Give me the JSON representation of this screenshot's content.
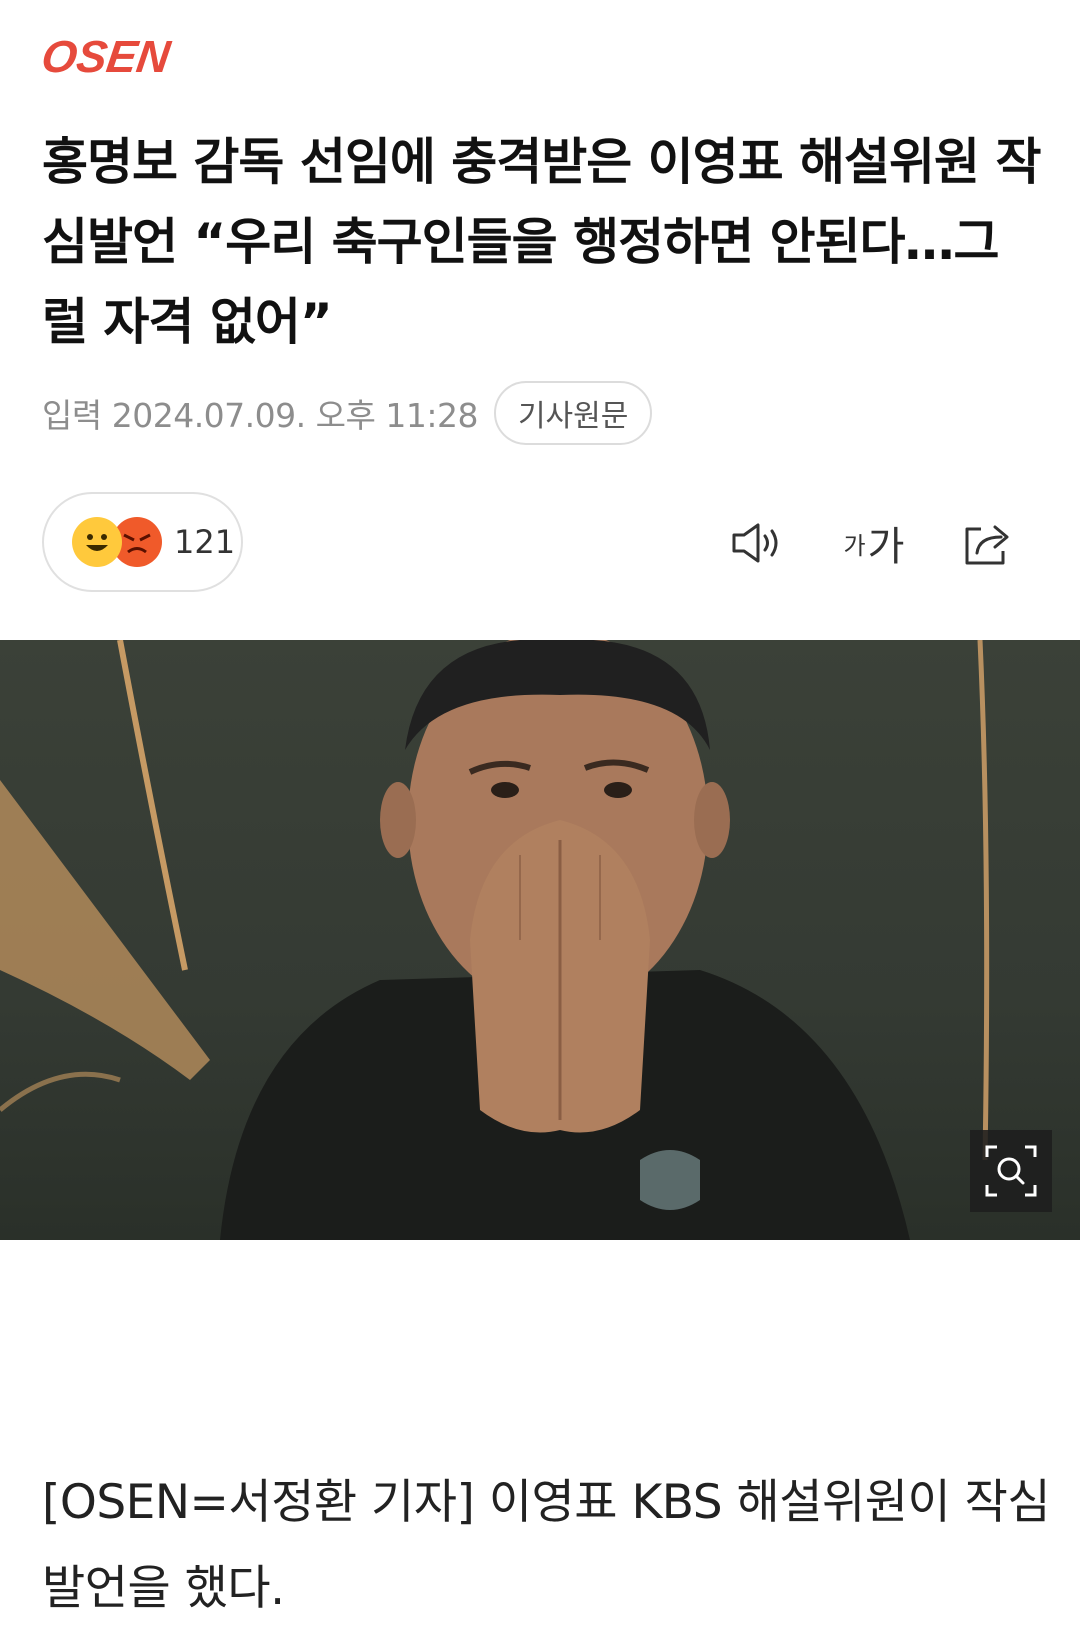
{
  "brand": {
    "logo_text": "OSEN",
    "logo_color": "#e64a3c"
  },
  "article": {
    "headline": "홍명보 감독 선임에 충격받은 이영표 해설위원 작심발언 “우리 축구인들을 행정하면 안된다…그럴 자격 없어”",
    "date": "입력 2024.07.09. 오후 11:28",
    "source_button": "기사원문",
    "body": "[OSEN=서정환 기자] 이영표 KBS 해설위원이 작심발언을 했다."
  },
  "reactions": {
    "count": "121",
    "icons": [
      "smile-emoji",
      "angry-emoji"
    ]
  },
  "toolbar": {
    "audio_icon": "speaker-icon",
    "font_small": "가",
    "font_large": "가",
    "share_icon": "share-icon"
  },
  "photo": {
    "subject": "man-covering-mouth",
    "zoom_icon": "zoom-icon"
  },
  "colors": {
    "headline": "#111111",
    "meta": "#8d8d8d",
    "border": "#e0e0e0"
  }
}
